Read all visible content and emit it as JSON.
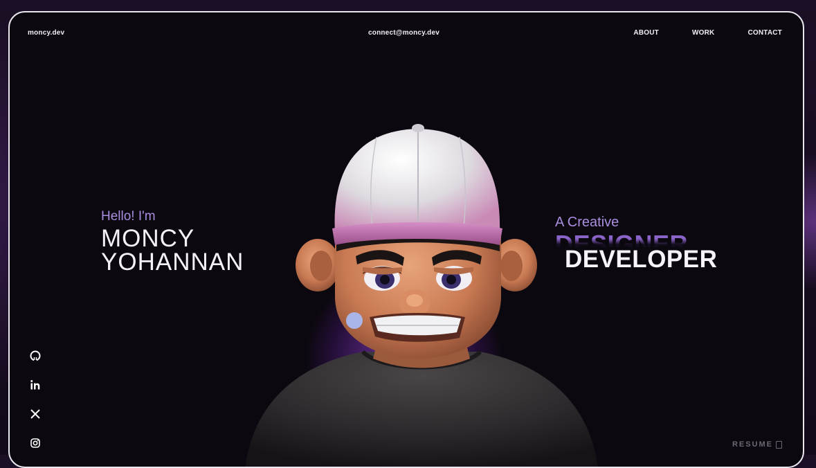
{
  "nav": {
    "logo": "moncy.dev",
    "email": "connect@moncy.dev",
    "links": [
      "ABOUT",
      "WORK",
      "CONTACT"
    ]
  },
  "intro": {
    "greeting": "Hello! I'm",
    "name_line1": "MONCY",
    "name_line2": "YOHANNAN"
  },
  "role": {
    "prefix": "A Creative",
    "title_faded": "DESIGNER",
    "title_main": "DEVELOPER"
  },
  "socials": [
    "github-icon",
    "linkedin-icon",
    "x-icon",
    "instagram-icon"
  ],
  "resume": {
    "label": "RESUME"
  },
  "colors": {
    "accent": "#a98ee0",
    "glow": "#9b4fe0",
    "background": "#0c080f"
  }
}
